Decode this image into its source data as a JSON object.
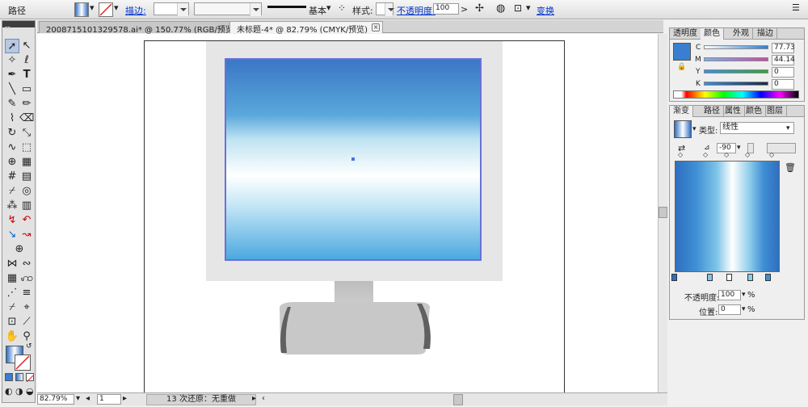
{
  "control_bar": {
    "object_type": "路径",
    "stroke_label": "描边:",
    "stroke_style": "基本",
    "style_label": "样式:",
    "opacity_label": "不透明度:",
    "opacity_value": "100",
    "opacity_unit": ">",
    "transform_label": "变换"
  },
  "document_tabs": [
    {
      "title": "2008715101329578.ai* @ 150.77% (RGB/预览)"
    },
    {
      "title": "未标题-4* @ 82.79% (CMYK/预览)"
    }
  ],
  "status_bar": {
    "zoom": "82.79%",
    "page": "1",
    "undo_text": "13 次还原：无重做"
  },
  "color_panel": {
    "tabs": [
      "透明度",
      "颜色",
      "外观",
      "描边"
    ],
    "active_tab": "颜色",
    "channels": [
      {
        "label": "C",
        "value": "77.73",
        "color": "#2f7fd0"
      },
      {
        "label": "M",
        "value": "44.14",
        "color": "#c050a0"
      },
      {
        "label": "Y",
        "value": "0",
        "color": "#38a038"
      },
      {
        "label": "K",
        "value": "0",
        "color": "#3070c0"
      }
    ],
    "fill_color": "#3a7fcf"
  },
  "gradient_panel": {
    "tabs": [
      "渐变",
      "路径",
      "属性",
      "颜色",
      "图层"
    ],
    "active_tab": "渐变",
    "type_label": "类型:",
    "type_value": "线性",
    "angle_value": "-90",
    "opacity_label": "不透明度:",
    "opacity_value": "100",
    "opacity_unit": "%",
    "position_label": "位置:",
    "position_value": "0",
    "position_unit": "%"
  },
  "colors": {
    "gradient_blue_dark": "#2f6fc0",
    "gradient_blue_mid": "#5ab8e8",
    "gradient_white": "#ffffff",
    "screen_frame": "#e6e6e6",
    "stand_gray": "#c8c8c8",
    "selection_blue": "#6a70d8"
  }
}
